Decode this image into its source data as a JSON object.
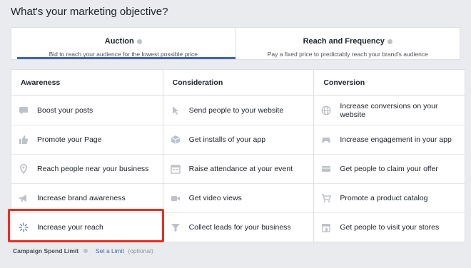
{
  "page": {
    "heading": "What's your marketing objective?"
  },
  "bidding": {
    "options": [
      {
        "title": "Auction",
        "subtitle": "Bid to reach your audience for the lowest possible price",
        "selected": true
      },
      {
        "title": "Reach and Frequency",
        "subtitle": "Pay a fixed price to predictably reach your brand's audience",
        "selected": false
      }
    ]
  },
  "objectives": {
    "columns": [
      {
        "header": "Awareness",
        "items": [
          {
            "label": "Boost your posts",
            "icon": "speech-bubble-icon"
          },
          {
            "label": "Promote your Page",
            "icon": "thumbs-up-icon"
          },
          {
            "label": "Reach people near your business",
            "icon": "location-pin-icon"
          },
          {
            "label": "Increase brand awareness",
            "icon": "megaphone-icon"
          },
          {
            "label": "Increase your reach",
            "icon": "sparkle-icon"
          }
        ]
      },
      {
        "header": "Consideration",
        "items": [
          {
            "label": "Send people to your website",
            "icon": "cursor-icon"
          },
          {
            "label": "Get installs of your app",
            "icon": "cube-icon"
          },
          {
            "label": "Raise attendance at your event",
            "icon": "calendar-icon"
          },
          {
            "label": "Get video views",
            "icon": "video-camera-icon"
          },
          {
            "label": "Collect leads for your business",
            "icon": "funnel-icon"
          }
        ]
      },
      {
        "header": "Conversion",
        "items": [
          {
            "label": "Increase conversions on your website",
            "icon": "globe-icon"
          },
          {
            "label": "Increase engagement in your app",
            "icon": "game-controller-icon"
          },
          {
            "label": "Get people to claim your offer",
            "icon": "ticket-icon"
          },
          {
            "label": "Promote a product catalog",
            "icon": "shopping-cart-icon"
          },
          {
            "label": "Get people to visit your stores",
            "icon": "storefront-icon"
          }
        ]
      }
    ]
  },
  "footer": {
    "label": "Campaign Spend Limit",
    "link": "Set a Limit",
    "optional": "(optional)"
  },
  "colors": {
    "background": "#e9ebee",
    "accent": "#4267b2",
    "highlight": "#e7311e",
    "icon": "#bec3c9"
  }
}
